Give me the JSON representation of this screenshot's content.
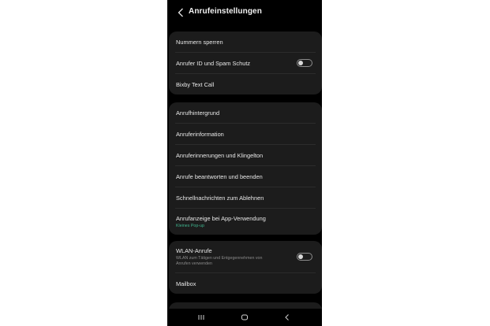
{
  "header": {
    "title": "Anrufeinstellungen",
    "back_icon": "chevron-left-icon"
  },
  "group1": {
    "items": [
      {
        "label": "Nummern sperren"
      },
      {
        "label": "Anrufer ID und Spam Schutz",
        "toggle": false
      },
      {
        "label": "Bixby Text Call"
      }
    ]
  },
  "group2": {
    "items": [
      {
        "label": "Anrufhintergrund"
      },
      {
        "label": "Anruferinformation"
      },
      {
        "label": "Anruferinnerungen und Klingelton"
      },
      {
        "label": "Anrufe beantworten und beenden"
      },
      {
        "label": "Schnellnachrichten zum Ablehnen"
      },
      {
        "label": "Anrufanzeige bei App-Verwendung",
        "subtitle": "Kleines Pop-up"
      }
    ]
  },
  "group3": {
    "items": [
      {
        "label": "WLAN-Anrufe",
        "subtitle": "WLAN zum Tätigen und Entgegennehmen von Anrufen verwenden",
        "toggle": false
      },
      {
        "label": "Mailbox"
      }
    ]
  },
  "navbar": {
    "recents_icon": "recent-apps-icon",
    "home_icon": "home-icon",
    "back_icon": "back-icon"
  },
  "colors": {
    "background": "#000000",
    "card": "#1c1c1c",
    "accent_green": "#3fb58e"
  }
}
